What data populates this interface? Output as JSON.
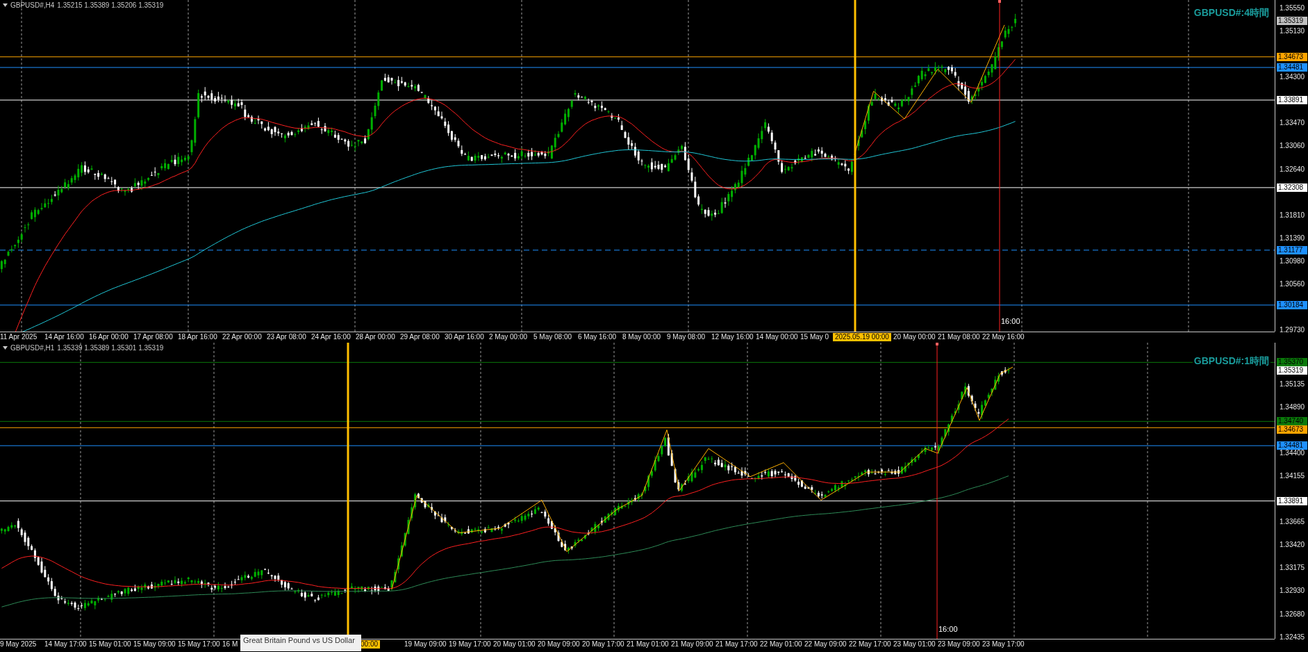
{
  "panels": [
    {
      "header": {
        "symbol": "GBPUSD#,H4",
        "prices": [
          "1.35215",
          "1.35389",
          "1.35206",
          "1.35319"
        ]
      },
      "title": "GBPUSD#:4時間",
      "price_ticks": [
        "1.35550",
        "1.35130",
        "1.34300",
        "1.33470",
        "1.33060",
        "1.32640",
        "1.31810",
        "1.31390",
        "1.30980",
        "1.30560",
        "1.29730"
      ],
      "price_lines": [
        {
          "label": "1.35319",
          "kind": "current",
          "color": "#c0c0c0"
        },
        {
          "label": "1.34673",
          "kind": "solid",
          "color": "#ffa500"
        },
        {
          "label": "1.34481",
          "kind": "solid",
          "color": "#1e90ff"
        },
        {
          "label": "1.33891",
          "kind": "solid",
          "color": "#ffffff"
        },
        {
          "label": "1.32308",
          "kind": "solid",
          "color": "#ffffff"
        },
        {
          "label": "1.31177",
          "kind": "dashed",
          "color": "#1e90ff"
        },
        {
          "label": "1.30184",
          "kind": "solid",
          "color": "#1e90ff"
        }
      ],
      "cursor_label": "16:00",
      "time_labels": [
        {
          "text": "11 Apr 2025",
          "kind": "tick"
        },
        {
          "text": "14 Apr 16:00",
          "kind": "tick"
        },
        {
          "text": "16 Apr 00:00",
          "kind": "tick"
        },
        {
          "text": "17 Apr 08:00",
          "kind": "tick"
        },
        {
          "text": "18 Apr 16:00",
          "kind": "tick"
        },
        {
          "text": "22 Apr 00:00",
          "kind": "tick"
        },
        {
          "text": "23 Apr 08:00",
          "kind": "tick"
        },
        {
          "text": "24 Apr 16:00",
          "kind": "tick"
        },
        {
          "text": "28 Apr 00:00",
          "kind": "tick"
        },
        {
          "text": "29 Apr 08:00",
          "kind": "tick"
        },
        {
          "text": "30 Apr 16:00",
          "kind": "tick"
        },
        {
          "text": "2 May 00:00",
          "kind": "tick"
        },
        {
          "text": "5 May 08:00",
          "kind": "tick"
        },
        {
          "text": "6 May 16:00",
          "kind": "tick"
        },
        {
          "text": "8 May 00:00",
          "kind": "tick"
        },
        {
          "text": "9 May 08:00",
          "kind": "tick"
        },
        {
          "text": "12 May 16:00",
          "kind": "tick"
        },
        {
          "text": "14 May 00:00",
          "kind": "tick"
        },
        {
          "text": "15 May 0",
          "kind": "tick"
        },
        {
          "text": "2025.05.19 00:00",
          "kind": "marker"
        },
        {
          "text": "20 May 00:00",
          "kind": "tick"
        },
        {
          "text": "21 May 08:00",
          "kind": "tick"
        },
        {
          "text": "22 May 16:00",
          "kind": "tick"
        }
      ]
    },
    {
      "header": {
        "symbol": "GBPUSD#,H1",
        "prices": [
          "1.35339",
          "1.35389",
          "1.35301",
          "1.35319"
        ]
      },
      "title": "GBPUSD#:1時間",
      "price_ticks": [
        "1.35135",
        "1.34890",
        "1.34400",
        "1.34155",
        "1.33665",
        "1.33420",
        "1.33175",
        "1.32930",
        "1.32680",
        "1.32435"
      ],
      "price_lines": [
        {
          "label": "1.35370",
          "kind": "solid",
          "color": "#0a7a0a"
        },
        {
          "label": "1.35319",
          "kind": "current",
          "color": "#ffffff"
        },
        {
          "label": "1.34740",
          "kind": "solid",
          "color": "#0a7a0a"
        },
        {
          "label": "1.34673",
          "kind": "solid",
          "color": "#ffa500"
        },
        {
          "label": "1.34481",
          "kind": "solid",
          "color": "#1e90ff"
        },
        {
          "label": "1.33891",
          "kind": "solid",
          "color": "#ffffff"
        }
      ],
      "cursor_label": "16:00",
      "tooltip": "Great Britain Pound vs US Dollar",
      "time_labels": [
        {
          "text": "9 May 2025",
          "kind": "tick"
        },
        {
          "text": "14 May 17:00",
          "kind": "tick"
        },
        {
          "text": "15 May 01:00",
          "kind": "tick"
        },
        {
          "text": "15 May 09:00",
          "kind": "tick"
        },
        {
          "text": "15 May 17:00",
          "kind": "tick"
        },
        {
          "text": "16 M",
          "kind": "tick"
        },
        {
          "text": "00:00",
          "kind": "marker"
        },
        {
          "text": "19 May 09:00",
          "kind": "tick"
        },
        {
          "text": "19 May 17:00",
          "kind": "tick"
        },
        {
          "text": "20 May 01:00",
          "kind": "tick"
        },
        {
          "text": "20 May 09:00",
          "kind": "tick"
        },
        {
          "text": "20 May 17:00",
          "kind": "tick"
        },
        {
          "text": "21 May 01:00",
          "kind": "tick"
        },
        {
          "text": "21 May 09:00",
          "kind": "tick"
        },
        {
          "text": "21 May 17:00",
          "kind": "tick"
        },
        {
          "text": "22 May 01:00",
          "kind": "tick"
        },
        {
          "text": "22 May 09:00",
          "kind": "tick"
        },
        {
          "text": "22 May 17:00",
          "kind": "tick"
        },
        {
          "text": "23 May 01:00",
          "kind": "tick"
        },
        {
          "text": "23 May 09:00",
          "kind": "tick"
        },
        {
          "text": "23 May 17:00",
          "kind": "tick"
        }
      ]
    }
  ]
}
